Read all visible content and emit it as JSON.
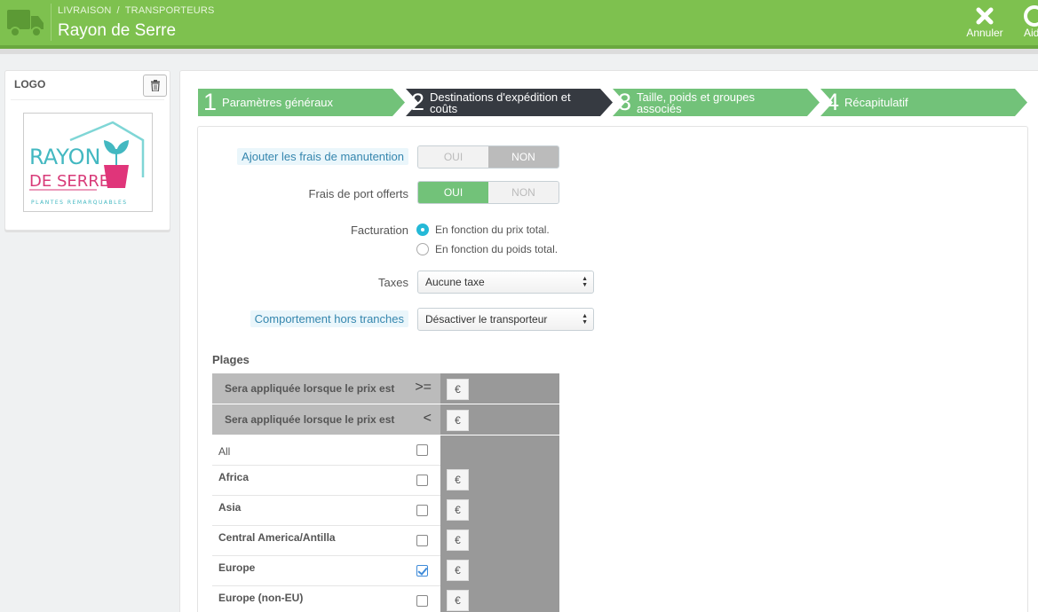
{
  "header": {
    "breadcrumb": [
      "LIVRAISON",
      "TRANSPORTEURS"
    ],
    "breadcrumb_sep": "/",
    "title": "Rayon de Serre",
    "buttons": {
      "cancel": "Annuler",
      "help": "Aide"
    },
    "icons": {
      "left": "truck-icon",
      "cancel": "close-icon",
      "help": "lifebuoy-icon"
    },
    "color": "#7ec14f"
  },
  "logo_panel": {
    "title": "LOGO",
    "logo_text": {
      "line1": "RAYON",
      "line2": "DE SERRE",
      "tagline": "PLANTES REMARQUABLES"
    }
  },
  "steps": [
    {
      "num": "1",
      "label": "Paramètres généraux",
      "state": "done"
    },
    {
      "num": "2",
      "label": "Destinations d'expédition et coûts",
      "state": "active"
    },
    {
      "num": "3",
      "label": "Taille, poids et groupes associés",
      "state": "todo"
    },
    {
      "num": "4",
      "label": "Récapitulatif",
      "state": "todo"
    }
  ],
  "form": {
    "handling": {
      "label": "Ajouter les frais de manutention",
      "yes": "OUI",
      "no": "NON",
      "value": "NON"
    },
    "free_shipping": {
      "label": "Frais de port offerts",
      "yes": "OUI",
      "no": "NON",
      "value": "OUI"
    },
    "billing": {
      "label": "Facturation",
      "options": [
        "En fonction du prix total.",
        "En fonction du poids total."
      ],
      "selected": "En fonction du prix total."
    },
    "taxes": {
      "label": "Taxes",
      "value": "Aucune taxe"
    },
    "out_of_range": {
      "label": "Comportement hors tranches",
      "value": "Désactiver le transporteur"
    }
  },
  "ranges": {
    "title": "Plages",
    "headers": [
      {
        "text": "Sera appliquée lorsque le prix est",
        "op": ">=",
        "currency": "€"
      },
      {
        "text": "Sera appliquée lorsque le prix est",
        "op": "<",
        "currency": "€"
      }
    ],
    "rows": [
      {
        "name": "All",
        "checked": false,
        "currency": ""
      },
      {
        "name": "Africa",
        "checked": false,
        "currency": "€"
      },
      {
        "name": "Asia",
        "checked": false,
        "currency": "€"
      },
      {
        "name": "Central America/Antilla",
        "checked": false,
        "currency": "€"
      },
      {
        "name": "Europe",
        "checked": true,
        "currency": "€"
      },
      {
        "name": "Europe (non-EU)",
        "checked": false,
        "currency": "€"
      }
    ]
  }
}
